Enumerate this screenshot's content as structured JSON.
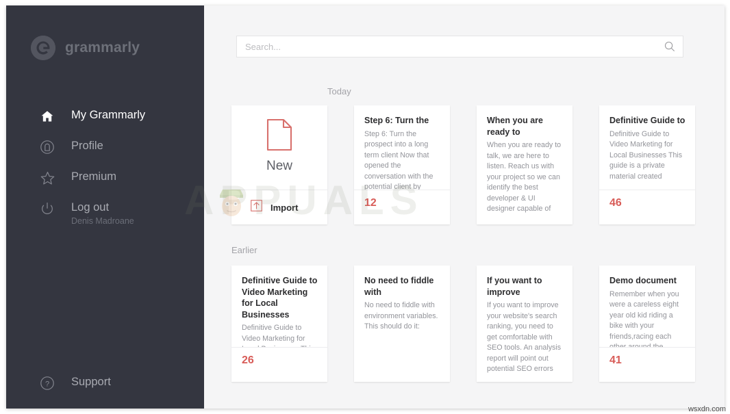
{
  "brand": {
    "name": "grammarly",
    "logo_icon": "grammarly-g-logo"
  },
  "colors": {
    "sidebar_bg": "#343640",
    "main_bg": "#f5f5f6",
    "card_bg": "#ffffff",
    "accent_red": "#d85c58",
    "muted_text": "#93949a"
  },
  "sidebar": {
    "items": [
      {
        "label": "My Grammarly",
        "icon": "home-icon",
        "active": true,
        "sub": ""
      },
      {
        "label": "Profile",
        "icon": "profile-icon",
        "active": false,
        "sub": ""
      },
      {
        "label": "Premium",
        "icon": "star-icon",
        "active": false,
        "sub": ""
      },
      {
        "label": "Log out",
        "icon": "power-icon",
        "active": false,
        "sub": "Denis Madroane"
      }
    ],
    "support": {
      "label": "Support",
      "icon": "question-circle-icon"
    }
  },
  "search": {
    "placeholder": "Search...",
    "value": "",
    "icon": "search-icon"
  },
  "sections": {
    "today_label": "Today",
    "earlier_label": "Earlier"
  },
  "new_card": {
    "label": "New",
    "doc_icon": "new-document-icon",
    "import_label": "Import",
    "import_icon": "import-upload-icon"
  },
  "today_cards": [
    {
      "title": "Step 6: Turn the",
      "snippet": "Step 6: Turn the prospect into a long term client Now that opened the conversation with the potential client by",
      "count": "12",
      "has_count": true
    },
    {
      "title": "When you are ready to",
      "snippet": "When you are ready to talk, we are here to listen. Reach us with your project so we can identify the best developer & UI designer capable of",
      "count": "",
      "has_count": false
    },
    {
      "title": "Definitive Guide to",
      "snippet": "Definitive Guide to Video Marketing for Local Businesses This guide is a private material created",
      "count": "46",
      "has_count": true
    }
  ],
  "earlier_cards": [
    {
      "title": "Definitive Guide to Video Marketing for Local Businesses",
      "snippet": "Definitive Guide to Video Marketing for Local Businesses This",
      "count": "26",
      "has_count": true
    },
    {
      "title": "No need to fiddle with",
      "snippet": "No need to fiddle with environment variables. This should do it:",
      "count": "",
      "has_count": false
    },
    {
      "title": "If you want to improve",
      "snippet": "If you want to improve your website's search ranking, you need to get comfortable with SEO tools. An analysis report will point out potential SEO errors",
      "count": "",
      "has_count": false
    },
    {
      "title": "Demo document",
      "snippet": "Remember when you were a careless eight year old kid riding a bike with your friends,racing each other around the",
      "count": "41",
      "has_count": true
    }
  ],
  "watermarks": {
    "appuals": "APPUALS",
    "wsxdn": "wsxdn.com"
  }
}
